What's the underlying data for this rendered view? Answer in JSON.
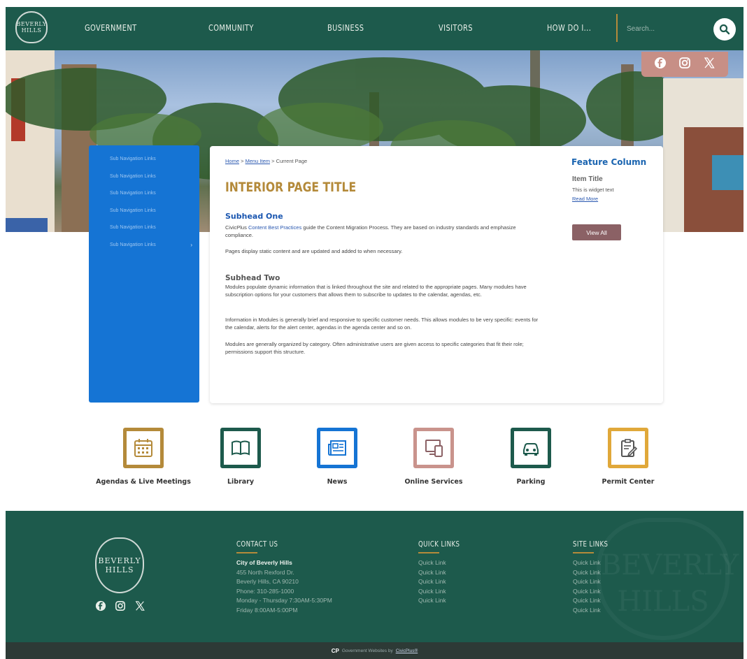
{
  "header": {
    "logo_text": [
      "BEVERLY",
      "HILLS"
    ],
    "nav": [
      "GOVERNMENT",
      "COMMUNITY",
      "BUSINESS",
      "VISITORS",
      "HOW DO I..."
    ],
    "search_placeholder": "Search..."
  },
  "hero": {
    "social": [
      "facebook-icon",
      "instagram-icon",
      "x-icon"
    ]
  },
  "subnav": {
    "items": [
      "Sub Navigation Links",
      "Sub Navigation Links",
      "Sub Navigation Links",
      "Sub Navigation Links",
      "Sub Navigation Links",
      "Sub Navigation Links"
    ],
    "chevron": "›"
  },
  "content": {
    "breadcrumb": {
      "home": "Home",
      "sep1": " > ",
      "menu_item": "Menu Item",
      "sep2": " > ",
      "current": "Current Page"
    },
    "title": "INTERIOR PAGE TITLE",
    "subhead_one": "Subhead One",
    "para1_pre": "CivicPlus ",
    "para1_link": "Content Best Practices",
    "para1_post": " guide the Content Migration Process. They are based on industry standards and emphasize compliance.",
    "para2": "Pages display static content and are updated and added to when necessary.",
    "subhead_two": "Subhead Two",
    "para3": "Modules populate dynamic information that is linked throughout the site and related to the appropriate pages. Many modules have subscription options for your customers that allows them to subscribe to updates to the calendar, agendas, etc.",
    "para4": "Information in Modules is generally brief and responsive to specific customer needs. This allows modules to be very specific: events for the calendar, alerts for the alert center, agendas in the agenda center and so on.",
    "para5": "Modules are generally organized by category. Often administrative users are given access to specific categories that fit their role; permissions support this structure."
  },
  "feature": {
    "title": "Feature Column",
    "item_title": "Item Title",
    "widget_text": "This is widget text",
    "read_more": "Read More",
    "view_all": "View All"
  },
  "tiles": [
    {
      "label": "Agendas & Live Meetings",
      "icon": "calendar-icon",
      "color": "#b48a3a"
    },
    {
      "label": "Library",
      "icon": "book-icon",
      "color": "#1d5a4c"
    },
    {
      "label": "News",
      "icon": "newspaper-icon",
      "color": "#1574d4"
    },
    {
      "label": "Online Services",
      "icon": "devices-icon",
      "color": "#c9938c"
    },
    {
      "label": "Parking",
      "icon": "car-icon",
      "color": "#1d5a4c"
    },
    {
      "label": "Permit Center",
      "icon": "clipboard-icon",
      "color": "#e0a83a"
    }
  ],
  "footer": {
    "logo_text": [
      "BEVERLY",
      "HILLS"
    ],
    "watermark_text": [
      "BEVERLY",
      "HILLS"
    ],
    "contact_heading": "CONTACT US",
    "contact": {
      "name": "City of Beverly Hills",
      "address": "455 North Rexford Dr.",
      "city": "Beverly Hills, CA 90210",
      "phone": "Phone: 310-285-1000",
      "hours1": "Monday - Thursday 7:30AM-5:30PM",
      "hours2": "Friday 8:00AM-5:00PM"
    },
    "quick_links_heading": "QUICK LINKS",
    "quick_links": [
      "Quick Link",
      "Quick Link",
      "Quick Link",
      "Quick Link",
      "Quick Link"
    ],
    "site_links_heading": "SITE LINKS",
    "site_links": [
      "Quick Link",
      "Quick Link",
      "Quick Link",
      "Quick Link",
      "Quick Link",
      "Quick Link"
    ]
  },
  "copyright": {
    "logo": "CP",
    "text": "Government Websites by ",
    "link": "CivicPlus®"
  }
}
